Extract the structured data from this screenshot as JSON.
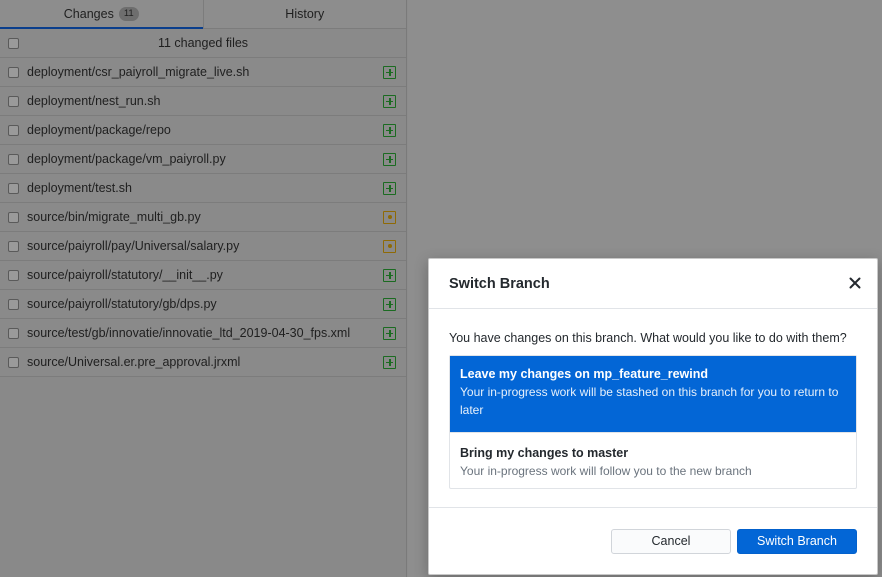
{
  "tabs": [
    {
      "label": "Changes",
      "badge": "11",
      "active": true
    },
    {
      "label": "History",
      "active": false
    }
  ],
  "changes": {
    "summary": "11 changed files",
    "files": [
      {
        "path": "deployment/csr_paiyroll_migrate_live.sh",
        "status": "new"
      },
      {
        "path": "deployment/nest_run.sh",
        "status": "new"
      },
      {
        "path": "deployment/package/repo",
        "status": "new"
      },
      {
        "path": "deployment/package/vm_paiyroll.py",
        "status": "new"
      },
      {
        "path": "deployment/test.sh",
        "status": "new"
      },
      {
        "path": "source/bin/migrate_multi_gb.py",
        "status": "modified"
      },
      {
        "path": "source/paiyroll/pay/Universal/salary.py",
        "status": "modified"
      },
      {
        "path": "source/paiyroll/statutory/__init__.py",
        "status": "new"
      },
      {
        "path": "source/paiyroll/statutory/gb/dps.py",
        "status": "new"
      },
      {
        "path": "source/test/gb/innovatie/innovatie_ltd_2019-04-30_fps.xml",
        "status": "new"
      },
      {
        "path": "source/Universal.er.pre_approval.jrxml",
        "status": "new"
      }
    ]
  },
  "dialog": {
    "title": "Switch Branch",
    "prompt": "You have changes on this branch. What would you like to do with them?",
    "options": [
      {
        "title": "Leave my changes on mp_feature_rewind",
        "description": "Your in-progress work will be stashed on this branch for you to return to later",
        "selected": true
      },
      {
        "title": "Bring my changes to master",
        "description": "Your in-progress work will follow you to the new branch",
        "selected": false
      }
    ],
    "cancel_label": "Cancel",
    "confirm_label": "Switch Branch"
  },
  "colors": {
    "accent": "#0366d6",
    "new_file": "#1b6b21",
    "modified_file": "#8f6a05"
  },
  "icons": {
    "new_status": "plus-square-icon",
    "modified_status": "dot-square-icon",
    "close": "close-icon"
  }
}
